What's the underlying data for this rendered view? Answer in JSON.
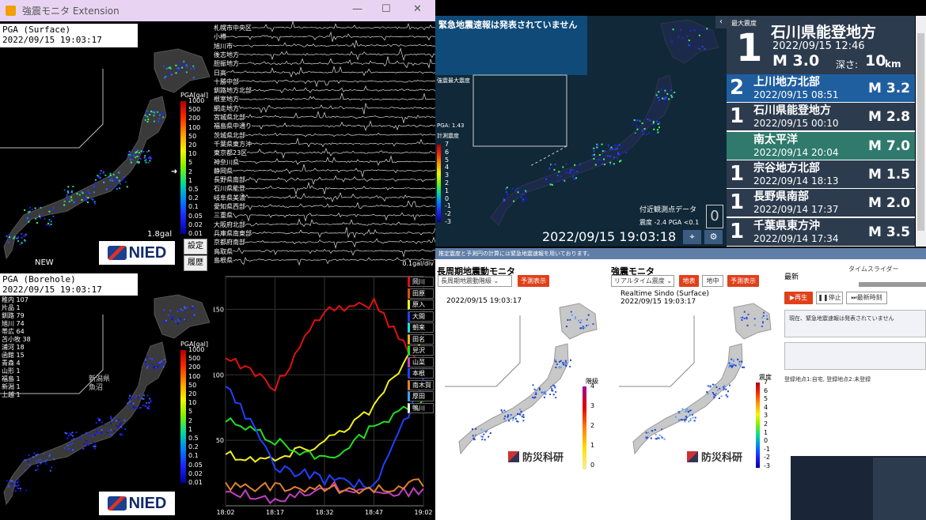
{
  "left_window": {
    "title": "強震モニタ Extension",
    "controls": {
      "minimize": "—",
      "maximize": "☐",
      "close": "✕"
    },
    "top_panel": {
      "label": "PGA (Surface)",
      "time": "2022/09/15 19:03:17",
      "scale_header": "PGA[gal]",
      "scale_ticks": [
        "1000",
        "500",
        "200",
        "100",
        "50",
        "20",
        "10",
        "5",
        "2",
        "1",
        "0.5",
        "0.2",
        "0.1",
        "0.05",
        "0.02",
        "0.01"
      ],
      "max_value": "1.8gal",
      "new_label": "NEW",
      "settings_button": "設定",
      "history_button": "履歴",
      "logo": "NIED"
    },
    "bottom_panel": {
      "label": "PGA (Borehole)",
      "time": "2022/09/15 19:03:17",
      "scale_header": "PGA[gal]",
      "scale_ticks": [
        "1000",
        "500",
        "200",
        "100",
        "50",
        "20",
        "10",
        "5",
        "2",
        "1",
        "0.5",
        "0.2",
        "0.1",
        "0.05",
        "0.02",
        "0.01"
      ],
      "counts": [
        "稚内 107",
        "片品 1",
        "釧路 79",
        "旭川 74",
        "帯広 64",
        "苫小牧 38",
        "浦河 18",
        "函館 15",
        "青森 4",
        "山形 1",
        "福島 1",
        "新潟 1",
        "上越 1"
      ],
      "region_label": "新潟県 魚沼",
      "logo": "NIED"
    },
    "waveform": {
      "labels": [
        "札幌市中央区",
        "小樽",
        "旭川市",
        "後志地方",
        "胆振地方",
        "日高",
        "十勝中部",
        "釧路地方北部",
        "根室地方",
        "網走地方",
        "宮城県北部",
        "福島県中通り",
        "茨城県北部",
        "千葉県東方沖",
        "東京都23区",
        "神奈川県",
        "静岡県",
        "長野県南部",
        "石川県能登",
        "岐阜県美濃",
        "愛知県西部",
        "三重県",
        "大阪府北部",
        "兵庫県南東部",
        "京都府南部",
        "鳥取県",
        "島根県"
      ],
      "scale_value": "0.1gal/div"
    },
    "graph": {
      "legend": [
        "岡川",
        "田原",
        "原入",
        "大間",
        "朝来",
        "田名",
        "見沢",
        "山菜",
        "本根",
        "南木賀",
        "厚田",
        "鴨川"
      ]
    }
  },
  "chart_data": {
    "type": "line",
    "title": "",
    "xlabel": "",
    "ylabel": "",
    "x": [
      "18:02",
      "18:17",
      "18:32",
      "18:47",
      "19:02"
    ],
    "ylim": [
      0,
      175
    ],
    "yticks": [
      50,
      100,
      150
    ],
    "series": [
      {
        "color": "#e01010",
        "values": [
          115,
          90,
          150,
          155,
          105
        ]
      },
      {
        "color": "#f0f020",
        "values": [
          40,
          35,
          50,
          75,
          130
        ]
      },
      {
        "color": "#20e020",
        "values": [
          65,
          50,
          35,
          60,
          80
        ]
      },
      {
        "color": "#2040ff",
        "values": [
          95,
          30,
          20,
          15,
          95
        ]
      },
      {
        "color": "#c040c0",
        "values": [
          10,
          5,
          15,
          12,
          10
        ]
      },
      {
        "color": "#e08030",
        "values": [
          15,
          14,
          12,
          13,
          18
        ]
      }
    ]
  },
  "eew": {
    "status": "緊急地震速報は発表されていません",
    "inset_label": "強震最大震度",
    "pga_label": "PGA: 1.43",
    "intensity_label": "計測震度",
    "intensity_ticks": [
      "7",
      "6",
      "5",
      "4",
      "3",
      "2",
      "1",
      "0",
      "-1",
      "-2",
      "-3"
    ],
    "nearby_label": "付近観測点データ",
    "nearby_count": "0",
    "nearby_values": "震度 -2.4   PGA <0.1",
    "timestamp": "2022/09/15 19:03:18"
  },
  "latest_quake": {
    "header": "最大震度",
    "intensity": "1",
    "region": "石川県能登地方",
    "datetime": "2022/09/15 12:46",
    "magnitude": "M 3.0",
    "depth_label": "深さ:",
    "depth_value": "10",
    "depth_unit": "km"
  },
  "quake_list": [
    {
      "intensity": "2",
      "region": "上川地方北部",
      "datetime": "2022/09/15 08:51",
      "magnitude": "M 3.2",
      "color": "#1f5fa0"
    },
    {
      "intensity": "1",
      "region": "石川県能登地方",
      "datetime": "2022/09/15 00:10",
      "magnitude": "M 2.8",
      "color": "#2d3b4e"
    },
    {
      "intensity": "",
      "region": "南太平洋",
      "datetime": "2022/09/14 20:04",
      "magnitude": "M 7.0",
      "color": "#2f7a6c"
    },
    {
      "intensity": "1",
      "region": "宗谷地方北部",
      "datetime": "2022/09/14 18:13",
      "magnitude": "M 1.5",
      "color": "#2d3b4e"
    },
    {
      "intensity": "1",
      "region": "長野県南部",
      "datetime": "2022/09/14 17:37",
      "magnitude": "M 2.0",
      "color": "#2d3b4e"
    },
    {
      "intensity": "1",
      "region": "千葉県東方沖",
      "datetime": "2022/09/14 17:34",
      "magnitude": "M 3.5",
      "color": "#2d3b4e"
    }
  ],
  "web": {
    "notice": "推定震度と予測円の計算には緊急地震速報を用いております。",
    "long_period": {
      "title": "長周期地震動モニタ",
      "dropdown": "長周期地震動階級",
      "forecast_button": "予測表示",
      "time": "2022/09/15 19:03:17",
      "scale_header": "階級",
      "scale_ticks": [
        "4",
        "3",
        "2",
        "1",
        "0"
      ],
      "logo": "防災科研"
    },
    "strong": {
      "title": "強震モニタ",
      "dropdown": "リアルタイム震度",
      "surface_button": "地表",
      "borehole_button": "地中",
      "forecast_button": "予測表示",
      "map_label": "Realtime Sindo (Surface)",
      "time": "2022/09/15 19:03:17",
      "scale_header": "震度",
      "scale_ticks": [
        "7",
        "6",
        "5",
        "4",
        "3",
        "2",
        "1",
        "0",
        "-1",
        "-2",
        "-3"
      ],
      "logo": "防災科研"
    },
    "control": {
      "latest_label": "最新",
      "time_slider_label": "タイムスライダー",
      "play_button": "▶再生",
      "stop_button": "❚❚停止",
      "latest_time_button": "⏭最新時刻",
      "status_text": "現在、緊急地震速報は発表されていません",
      "registered_points": "登録地点1:自宅, 登録地点2:未登録"
    }
  }
}
